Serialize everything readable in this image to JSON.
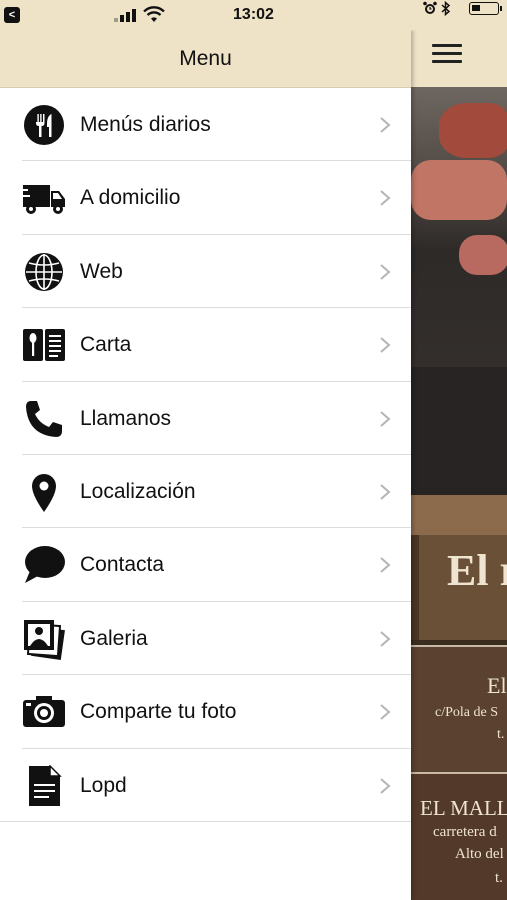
{
  "status_bar": {
    "time": "13:02",
    "back_glyph": "<"
  },
  "header": {
    "title": "Menu"
  },
  "menu": {
    "items": [
      {
        "label": "Menús diarios",
        "icon": "cutlery-icon"
      },
      {
        "label": "A domicilio",
        "icon": "delivery-truck-icon"
      },
      {
        "label": "Web",
        "icon": "globe-icon"
      },
      {
        "label": "Carta",
        "icon": "menu-card-icon"
      },
      {
        "label": "Llamanos",
        "icon": "phone-icon"
      },
      {
        "label": "Localización",
        "icon": "map-pin-icon"
      },
      {
        "label": "Contacta",
        "icon": "chat-bubble-icon"
      },
      {
        "label": "Galeria",
        "icon": "photo-gallery-icon"
      },
      {
        "label": "Comparte tu foto",
        "icon": "camera-icon"
      },
      {
        "label": "Lopd",
        "icon": "document-icon"
      }
    ]
  },
  "background_page": {
    "sign_text": "El r",
    "card1_title": "El",
    "card1_line1": "c/Pola de S",
    "card1_line2": "t.",
    "card2_title": "EL MALLU",
    "card2_line1": "carretera d",
    "card2_line2": "Alto del",
    "card2_line3": "t."
  },
  "colors": {
    "header_bg": "#efe3c7",
    "divider": "#dcdcdc",
    "chevron": "#b5b5b5"
  }
}
